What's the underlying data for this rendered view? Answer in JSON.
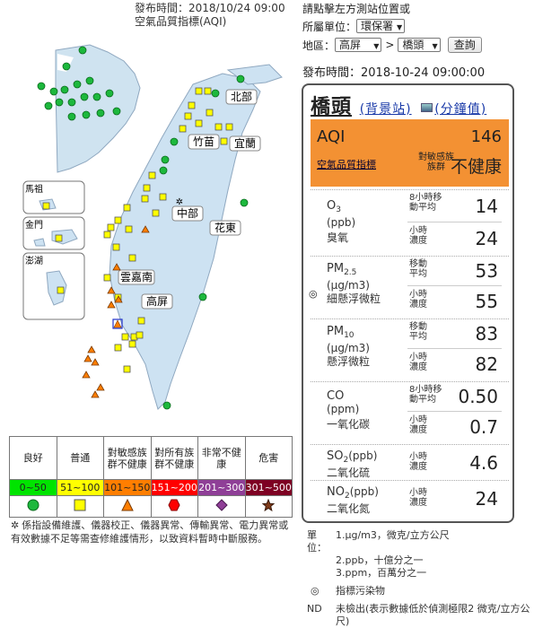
{
  "map_panel": {
    "publish_label": "發布時間：",
    "publish_time": "2018/10/24 09:00",
    "index_title": "空氣品質指標(AQI)",
    "regions": {
      "north": "北部",
      "zhumiao": "竹苗",
      "yilan": "宜蘭",
      "central": "中部",
      "hualien": "花東",
      "yunjianan": "雲嘉南",
      "kaoping": "高屏",
      "matsu": "馬祖",
      "kinmen": "金門",
      "penghu": "澎湖"
    }
  },
  "legend": {
    "headers": [
      "良好",
      "普通",
      "對敏感族群不健康",
      "對所有族群不健康",
      "非常不健康",
      "危害"
    ],
    "ranges": [
      "0~50",
      "51~100",
      "101~150",
      "151~200",
      "201~300",
      "301~500"
    ],
    "colors": [
      "#00e400",
      "#ffff00",
      "#ff7e00",
      "#ff0000",
      "#8f3f97",
      "#7e0023"
    ],
    "range_text_colors": [
      "#222",
      "#222",
      "#222",
      "#fff",
      "#fff",
      "#fff"
    ],
    "symbols": [
      "circle-green",
      "square-yellow",
      "triangle-orange",
      "hexagon-red",
      "diamond-purple",
      "star-brown"
    ]
  },
  "note": "係指設備維護、儀器校正、儀器異常、傳輸異常、電力異常或有效數據不足等需查修維護情形，以致資料暫時中斷服務。",
  "note_icon": "maintenance-icon",
  "selector": {
    "hint": "請點擊左方測站位置或",
    "agency_label": "所屬單位：",
    "agency_value": "環保署",
    "area_label": "地區：",
    "county_value": "高屏",
    "arrow": ">",
    "station_value": "橋頭",
    "query_label": "查詢"
  },
  "publish_panel": {
    "label": "發布時間：",
    "time": "2018-10-24 09:00:00"
  },
  "station": {
    "name": "橋頭",
    "bg_link": "(背景站)",
    "minute_link": "(分鐘值)",
    "aqi_label": "AQI",
    "aqi_value": "146",
    "aqi_link": "空氣品質指標",
    "group_line1": "對敏感族",
    "group_line2": "族群",
    "status": "不健康",
    "aqi_color": "#f39133"
  },
  "pollutants": [
    {
      "formula": "O",
      "sub": "3",
      "unit": "(ppb)",
      "cn": "臭氧",
      "r1_type": "8小時移動平均",
      "r1_val": "14",
      "r2_type": "小時濃度",
      "r2_val": "24"
    },
    {
      "formula": "PM",
      "sub": "2.5",
      "unit": "(μg/m3)",
      "cn": "細懸浮微粒",
      "r1_type": "移動平均",
      "r1_val": "53",
      "r2_type": "小時濃度",
      "r2_val": "55"
    },
    {
      "formula": "PM",
      "sub": "10",
      "unit": "(μg/m3)",
      "cn": "懸浮微粒",
      "r1_type": "移動平均",
      "r1_val": "83",
      "r2_type": "小時濃度",
      "r2_val": "82"
    },
    {
      "formula": "CO",
      "sub": "",
      "unit": "(ppm)",
      "cn": "一氧化碳",
      "r1_type": "8小時移動平均",
      "r1_val": "0.50",
      "r2_type": "小時濃度",
      "r2_val": "0.7"
    },
    {
      "formula": "SO",
      "sub": "2",
      "unit": "(ppb)",
      "cn": "二氧化硫",
      "r1_type": "小時濃度",
      "r1_val": "4.6"
    },
    {
      "formula": "NO",
      "sub": "2",
      "unit": "(ppb)",
      "cn": "二氧化氮",
      "r1_type": "小時濃度",
      "r1_val": "24"
    }
  ],
  "indicator_symbol": "◎",
  "units": {
    "label": "單位：",
    "l1": "1.μg/m3，微克/立方公尺",
    "l2": "2.ppb，十億分之一",
    "l3": "3.ppm，百萬分之一",
    "circle_key": "◎",
    "circle_desc": "指標污染物",
    "nd_key": "ND",
    "nd_desc": "未檢出(表示數據低於偵測極限2 微克/立方公尺)"
  },
  "footer_red": "ˍ"
}
